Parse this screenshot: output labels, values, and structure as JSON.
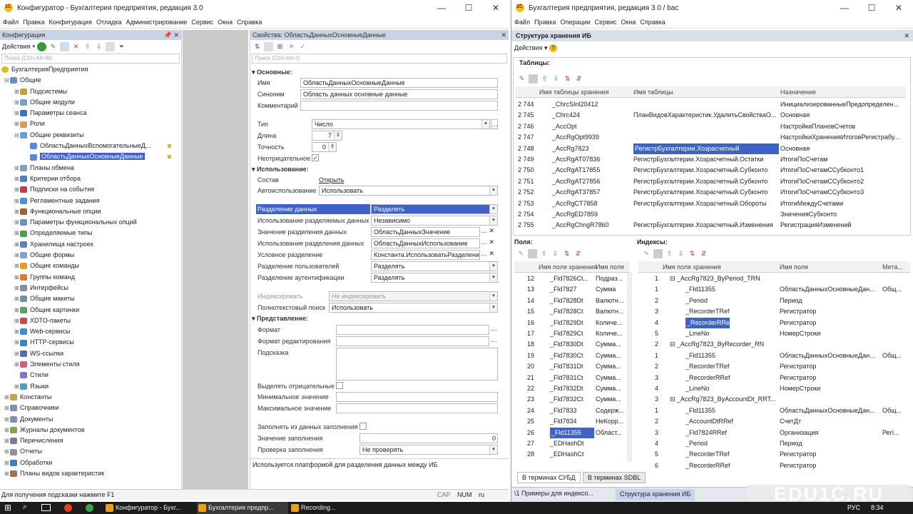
{
  "left_window": {
    "title": "Конфигуратор - Бухгалтерия предприятия, редакция 3.0",
    "menu": [
      "Файл",
      "Правка",
      "Конфигурация",
      "Отладка",
      "Администрирование",
      "Сервис",
      "Окна",
      "Справка"
    ]
  },
  "config_panel": {
    "title": "Конфигурация",
    "actions": "Действия",
    "search_placeholder": "Поиск (Ctrl+Alt+M)",
    "root": "БухгалтерияПредприятия",
    "items": [
      {
        "label": "Общие",
        "level": 0,
        "exp": "⊟",
        "color": "#6a8fc8"
      },
      {
        "label": "Подсистемы",
        "level": 1,
        "exp": "⊞",
        "color": "#c0a040"
      },
      {
        "label": "Общие модули",
        "level": 1,
        "exp": "⊞",
        "color": "#7aa0d0"
      },
      {
        "label": "Параметры сеанса",
        "level": 1,
        "exp": "⊞",
        "color": "#4070c0"
      },
      {
        "label": "Роли",
        "level": 1,
        "exp": "⊞",
        "color": "#d0a060"
      },
      {
        "label": "Общие реквизиты",
        "level": 1,
        "exp": "⊟",
        "color": "#6aa0d8"
      },
      {
        "label": "ОбластьДанныхВспомогательныеД...",
        "level": 2,
        "exp": "",
        "color": "#5a8ad0"
      },
      {
        "label": "ОбластьДанныхОсновныеДанные",
        "level": 2,
        "exp": "",
        "color": "#5a8ad0",
        "selected": true
      },
      {
        "label": "Планы обмена",
        "level": 1,
        "exp": "⊞",
        "color": "#80a0c0"
      },
      {
        "label": "Критерии отбора",
        "level": 1,
        "exp": "⊞",
        "color": "#5080c0"
      },
      {
        "label": "Подписки на события",
        "level": 1,
        "exp": "⊞",
        "color": "#c04040"
      },
      {
        "label": "Регламентные задания",
        "level": 1,
        "exp": "⊞",
        "color": "#5090d0"
      },
      {
        "label": "Функциональные опции",
        "level": 1,
        "exp": "⊞",
        "color": "#a06030"
      },
      {
        "label": "Параметры функциональных опций",
        "level": 1,
        "exp": "⊞",
        "color": "#7090c0"
      },
      {
        "label": "Определяемые типы",
        "level": 1,
        "exp": "⊞",
        "color": "#50a050"
      },
      {
        "label": "Хранилища настроек",
        "level": 1,
        "exp": "⊞",
        "color": "#6080c0"
      },
      {
        "label": "Общие формы",
        "level": 1,
        "exp": "⊞",
        "color": "#80a0d0"
      },
      {
        "label": "Общие команды",
        "level": 1,
        "exp": "⊞",
        "color": "#e0a030"
      },
      {
        "label": "Группы команд",
        "level": 1,
        "exp": "⊞",
        "color": "#d08030"
      },
      {
        "label": "Интерфейсы",
        "level": 1,
        "exp": "⊞",
        "color": "#8090a0"
      },
      {
        "label": "Общие макеты",
        "level": 1,
        "exp": "⊞",
        "color": "#7090b0"
      },
      {
        "label": "Общие картинки",
        "level": 1,
        "exp": "⊞",
        "color": "#60a060"
      },
      {
        "label": "XDTO-пакеты",
        "level": 1,
        "exp": "⊞",
        "color": "#c05050"
      },
      {
        "label": "Web-сервисы",
        "level": 1,
        "exp": "⊞",
        "color": "#4090d0"
      },
      {
        "label": "HTTP-сервисы",
        "level": 1,
        "exp": "⊞",
        "color": "#4080c0"
      },
      {
        "label": "WS-ссылки",
        "level": 1,
        "exp": "⊞",
        "color": "#5070b0"
      },
      {
        "label": "Элементы стиля",
        "level": 1,
        "exp": "⊞",
        "color": "#d06080"
      },
      {
        "label": "Стили",
        "level": 1,
        "exp": "",
        "color": "#9070c0"
      },
      {
        "label": "Языки",
        "level": 1,
        "exp": "⊞",
        "color": "#50a0c0"
      },
      {
        "label": "Константы",
        "level": 0,
        "exp": "⊞",
        "color": "#c0a060"
      },
      {
        "label": "Справочники",
        "level": 0,
        "exp": "⊞",
        "color": "#8090b0"
      },
      {
        "label": "Документы",
        "level": 0,
        "exp": "⊞",
        "color": "#8090b0"
      },
      {
        "label": "Журналы документов",
        "level": 0,
        "exp": "⊞",
        "color": "#90a040"
      },
      {
        "label": "Перечисления",
        "level": 0,
        "exp": "⊞",
        "color": "#7080a0"
      },
      {
        "label": "Отчеты",
        "level": 0,
        "exp": "⊞",
        "color": "#9090a0"
      },
      {
        "label": "Обработки",
        "level": 0,
        "exp": "⊞",
        "color": "#4080c0"
      },
      {
        "label": "Планы видов характеристик",
        "level": 0,
        "exp": "⊞",
        "color": "#a07050"
      }
    ]
  },
  "props": {
    "title": "Свойства: ОбластьДанныхОсновныеДанные",
    "search_placeholder": "Поиск (Ctrl+Alt+I)",
    "grp_main": "Основные:",
    "name_label": "Имя",
    "name_value": "ОбластьДанныхОсновныеДанные",
    "synonym_label": "Синоним",
    "synonym_value": "Область данных основные данные",
    "comment_label": "Комментарий",
    "type_label": "Тип",
    "type_value": "Число",
    "length_label": "Длина",
    "length_value": "7",
    "precision_label": "Точность",
    "precision_value": "0",
    "nonneg_label": "Неотрицательное",
    "nonneg_check": "✓",
    "grp_usage": "Использование:",
    "composition_label": "Состав",
    "composition_link": "Открыть",
    "autouse_label": "Автоиспользование",
    "autouse_value": "Использовать",
    "sep_label": "Разделение данных",
    "sep_value": "Разделять",
    "sepuse_label": "Использование разделяемых данных",
    "sepuse_value": "Независимо",
    "sepval_label": "Значение разделения данных",
    "sepval_value": "ОбластьДанныхЗначение",
    "sepuse2_label": "Использование разделения данных",
    "sepuse2_value": "ОбластьДанныхИспользование",
    "condsep_label": "Условное разделение",
    "condsep_value": "Константа.ИспользоватьРазделени...",
    "usersep_label": "Разделение пользователей",
    "usersep_value": "Разделять",
    "authsep_label": "Разделение аутентификации",
    "authsep_value": "Разделять",
    "index_label": "Индексировать",
    "index_value": "Не индексировать",
    "fts_label": "Полнотекстовый поиск",
    "fts_value": "Использовать",
    "grp_repr": "Представление:",
    "format_label": "Формат",
    "editformat_label": "Формат редактирования",
    "tooltip_label": "Подсказка",
    "highlight_label": "Выделять отрицательные",
    "min_label": "Минимальное значение",
    "max_label": "Максимальное значение",
    "fill_label": "Заполнять из данных заполнения",
    "fillval_label": "Значение заполнения",
    "fillval_value": "0",
    "check_label": "Проверка заполнения",
    "check_value": "Не проверять",
    "status": "Используется платформой для разделения данных между ИБ"
  },
  "right_window": {
    "title": "Бухгалтерия предприятия, редакция 3.0 / bac",
    "menu": [
      "Файл",
      "Правка",
      "Операции",
      "Сервис",
      "Окна",
      "Справка"
    ],
    "panel_title": "Структура хранения ИБ",
    "actions": "Действия",
    "tables_label": "Таблицы:",
    "tables_headers": [
      "Имя таблицы хранения",
      "Имя таблицы",
      "Назначение"
    ],
    "tables_rows": [
      [
        "2 744",
        "_ChrcSInl20412",
        "",
        "ИнициализированныеПредопределен..."
      ],
      [
        "2 745",
        "_Chrc424",
        "ПланВидовХарактеристик.УдалитьСвойстваО...",
        "Основная"
      ],
      [
        "2 746",
        "_AccOpt",
        "",
        "НастройкиПлановСчетов"
      ],
      [
        "2 747",
        "_AccRgOpt9939",
        "",
        "НастройкиХраненияИтоговРегистрабу..."
      ],
      [
        "2 748",
        "_AccRg7823",
        "РегистрБухгалтерии.Хозрасчетный",
        "Основная"
      ],
      [
        "2 749",
        "_AccRgAT07836",
        "РегистрБухгалтерии.Хозрасчетный.Остатки",
        "ИтогиПоСчетам"
      ],
      [
        "2 750",
        "_AccRgAT17855",
        "РегистрБухгалтерии.Хозрасчетный.Субконто",
        "ИтогиПоСчетамССубконто1"
      ],
      [
        "2 751",
        "_AccRgAT27856",
        "РегистрБухгалтерии.Хозрасчетный.Субконто",
        "ИтогиПоСчетамССубконто2"
      ],
      [
        "2 752",
        "_AccRgAT37857",
        "РегистрБухгалтерии.Хозрасчетный.Субконто",
        "ИтогиПоСчетамССубконто3"
      ],
      [
        "2 753",
        "_AccRgCT7858",
        "РегистрБухгалтерии.Хозрасчетный.Обороты",
        "ИтогиМеждуСчетами"
      ],
      [
        "2 754",
        "_AccRgED7859",
        "",
        "ЗначенияСубконто"
      ],
      [
        "2 755",
        "_AccRgChngR7860",
        "РегистрБухгалтерии.Хозрасчетный.Изменения",
        "РегистрацияИзменений"
      ]
    ],
    "fields_label": "Поля:",
    "indexes_label": "Индексы:",
    "fields_headers": [
      "Имя поля хранения",
      "Имя поля"
    ],
    "fields_rows": [
      [
        "12",
        "_Fld7826Ct...",
        "Подраз..."
      ],
      [
        "13",
        "_Fld7827",
        "Сумма"
      ],
      [
        "14",
        "_Fld7828Dt",
        "Валютн..."
      ],
      [
        "15",
        "_Fld7828Ct",
        "Валютн..."
      ],
      [
        "16",
        "_Fld7829Dt",
        "Количе..."
      ],
      [
        "17",
        "_Fld7829Ct",
        "Количе..."
      ],
      [
        "18",
        "_Fld7830Dt",
        "Сумма..."
      ],
      [
        "19",
        "_Fld7830Ct",
        "Сумма..."
      ],
      [
        "20",
        "_Fld7831Dt",
        "Сумма..."
      ],
      [
        "21",
        "_Fld7831Ct",
        "Сумма..."
      ],
      [
        "22",
        "_Fld7832Dt",
        "Сумма..."
      ],
      [
        "23",
        "_Fld7832Ct",
        "Сумма..."
      ],
      [
        "24",
        "_Fld7833",
        "Содерж..."
      ],
      [
        "25",
        "_Fld7834",
        "НеКорр..."
      ],
      [
        "26",
        "_Fld11355",
        "Област..."
      ],
      [
        "27",
        "_EDHashDt",
        ""
      ],
      [
        "28",
        "_EDHashCt",
        ""
      ]
    ],
    "idx_headers": [
      "Имя поля хранения",
      "Имя поля",
      "Мета..."
    ],
    "idx_rows": [
      [
        "1",
        "⊟ _AccRg7823_ByPeriod_TRN",
        "",
        "",
        0
      ],
      [
        "1",
        "_Fld11355",
        "ОбластьДанныхОсновныеДан...",
        "Общ...",
        1
      ],
      [
        "2",
        "_Period",
        "Период",
        "",
        1
      ],
      [
        "3",
        "_RecorderTRef",
        "Регистратор",
        "",
        1
      ],
      [
        "4",
        "_RecorderRRef",
        "Регистратор",
        "",
        1
      ],
      [
        "5",
        "_LineNo",
        "НомерСтроки",
        "",
        1
      ],
      [
        "2",
        "⊟ _AccRg7823_ByRecorder_RN",
        "",
        "",
        0
      ],
      [
        "1",
        "_Fld11355",
        "ОбластьДанныхОсновныеДан...",
        "Общ...",
        1
      ],
      [
        "2",
        "_RecorderTRef",
        "Регистратор",
        "",
        1
      ],
      [
        "3",
        "_RecorderRRef",
        "Регистратор",
        "",
        1
      ],
      [
        "4",
        "_LineNo",
        "НомерСтроки",
        "",
        1
      ],
      [
        "3",
        "⊟ _AccRg7823_ByAccountDt_RRT...",
        "",
        "",
        0
      ],
      [
        "1",
        "_Fld11355",
        "ОбластьДанныхОсновныеДан...",
        "Общ...",
        1
      ],
      [
        "2",
        "_AccountDtRRef",
        "СчетДт",
        "",
        1
      ],
      [
        "3",
        "_Fld7824RRef",
        "Организация",
        "Регі...",
        1
      ],
      [
        "4",
        "_Period",
        "Период",
        "",
        1
      ],
      [
        "5",
        "_RecorderTRef",
        "Регистратор",
        "",
        1
      ],
      [
        "6",
        "_RecorderRRef",
        "Регистратор",
        "",
        1
      ]
    ],
    "tab1": "В терминах СУБД",
    "tab2": "В терминах SDBL",
    "bottom_tab1": "\\1 Примеры для индексо...",
    "bottom_tab2": "Структура хранения ИБ"
  },
  "statusbar": {
    "hint": "Для получения подсказки нажмите F1",
    "cap": "CAP",
    "num": "NUM",
    "lang": "ru"
  },
  "watermark": "EDU1C.RU",
  "taskbar": {
    "t1": "Конфигуратор - Бухг...",
    "t2": "Бухгалтерия предпр...",
    "t3": "Recording...",
    "lang": "РУС",
    "time": "8:34"
  }
}
